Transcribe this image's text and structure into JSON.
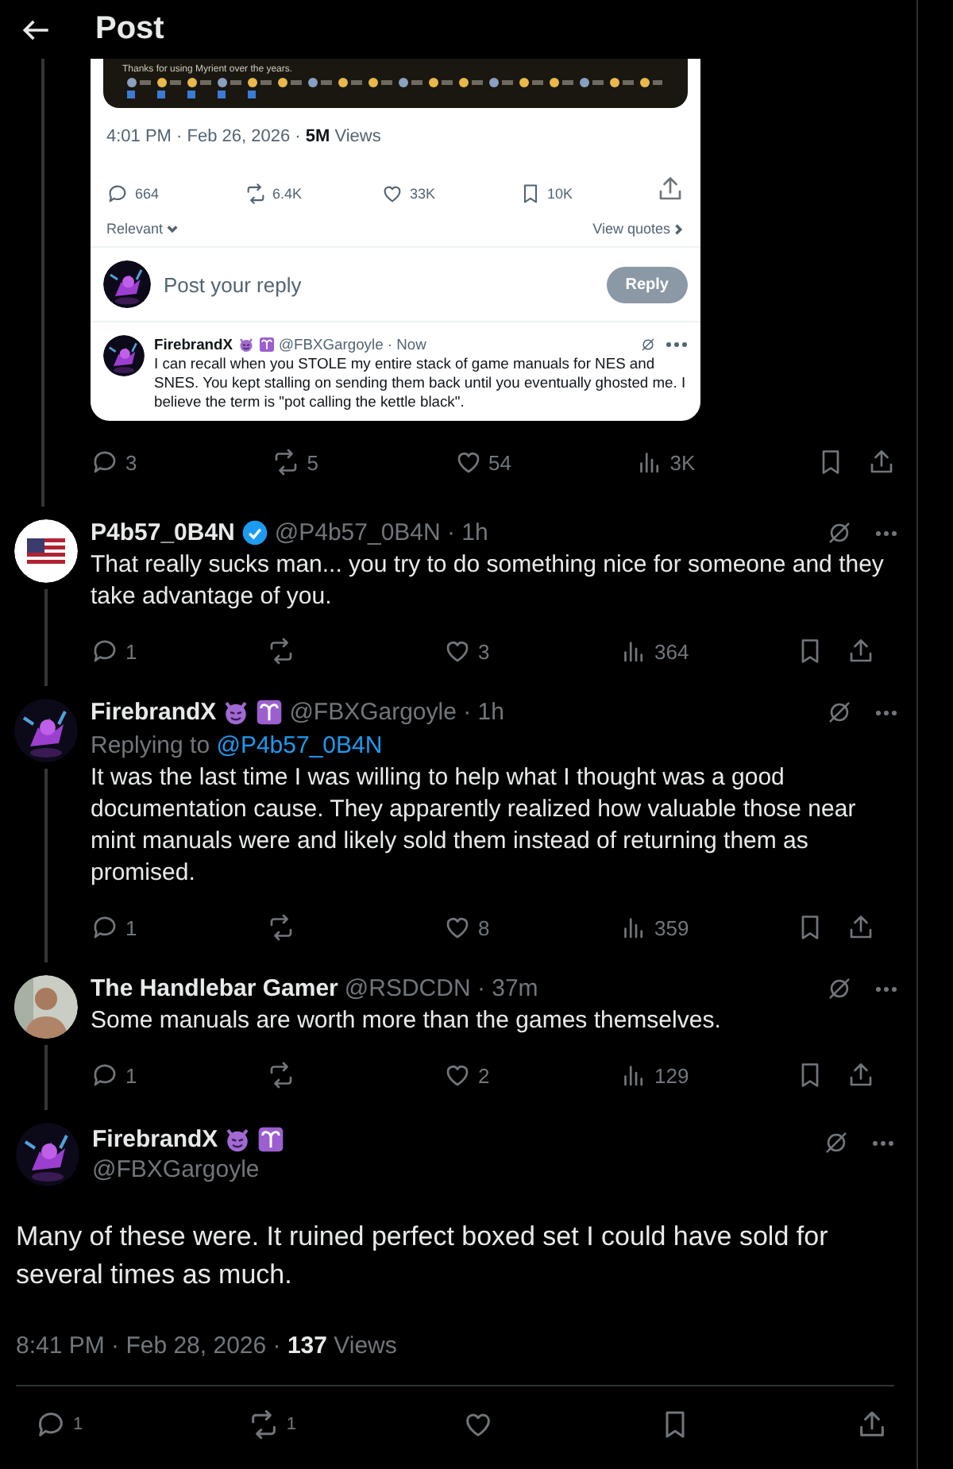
{
  "header": {
    "title": "Post"
  },
  "screenshot": {
    "banner_text": "Thanks for using Myrient over the years.",
    "timestamp": "4:01 PM · Feb 26, 2026 · **5M** Views",
    "actions": [
      {
        "kind": "reply",
        "count": "664"
      },
      {
        "kind": "repost",
        "count": "6.4K"
      },
      {
        "kind": "like",
        "count": "33K"
      },
      {
        "kind": "bookmark",
        "count": "10K"
      }
    ],
    "sort": "Relevant",
    "view_quotes": "View quotes",
    "composer": {
      "placeholder": "Post your reply",
      "button": "Reply"
    },
    "reply": {
      "name": "FirebrandX",
      "handle": "@FBXGargoyle · Now",
      "text": "I can recall when you STOLE my entire stack of game manuals for NES and SNES. You kept stalling on sending them back until you eventually ghosted me. I believe the term is \"pot calling the kettle black\"."
    }
  },
  "post_actions": [
    {
      "kind": "reply",
      "count": "3"
    },
    {
      "kind": "repost",
      "count": "5"
    },
    {
      "kind": "like",
      "count": "54"
    },
    {
      "kind": "views",
      "count": "3K"
    }
  ],
  "replies": [
    {
      "avatar": {
        "kind": "flag"
      },
      "name": "P4b57_0B4N",
      "verified": true,
      "handle": "@P4b57_0B4N · 1h",
      "text": "That really sucks man... you try to do something nice for someone and they take advantage of you.",
      "actions": [
        {
          "kind": "reply",
          "count": "1"
        },
        {
          "kind": "repost"
        },
        {
          "kind": "like",
          "count": "3"
        },
        {
          "kind": "views",
          "count": "364"
        }
      ]
    },
    {
      "avatar": {
        "kind": "creature"
      },
      "name": "FirebrandX",
      "verified": false,
      "badges": [
        {
          "kind": "devil"
        },
        {
          "kind": "aries"
        }
      ],
      "handle": "@FBXGargoyle · 1h",
      "replying_label": "Replying to",
      "replying_to": "@P4b57_0B4N",
      "text": "It was the last time I was willing to help what I thought was a good documentation cause. They apparently realized how valuable those near mint manuals were and likely sold them instead of returning them as promised.",
      "actions": [
        {
          "kind": "reply",
          "count": "1"
        },
        {
          "kind": "repost"
        },
        {
          "kind": "like",
          "count": "8"
        },
        {
          "kind": "views",
          "count": "359"
        }
      ]
    },
    {
      "avatar": {
        "kind": "person"
      },
      "name": "The Handlebar Gamer",
      "verified": false,
      "handle": "@RSDCDN · 37m",
      "text": "Some manuals are worth more than the games themselves.",
      "actions": [
        {
          "kind": "reply",
          "count": "1"
        },
        {
          "kind": "repost"
        },
        {
          "kind": "like",
          "count": "2"
        },
        {
          "kind": "views",
          "count": "129"
        }
      ]
    }
  ],
  "focused": {
    "avatar": {
      "kind": "creature"
    },
    "name": "FirebrandX",
    "badges": [
      {
        "kind": "devil"
      },
      {
        "kind": "aries"
      }
    ],
    "handle": "@FBXGargoyle",
    "text": "Many of these were. It ruined perfect boxed set I could have sold for several times as much.",
    "timestamp": "8:41 PM · Feb 28, 2026 · **137** Views",
    "actions": [
      {
        "kind": "reply",
        "count": "1"
      },
      {
        "kind": "repost",
        "count": "1"
      },
      {
        "kind": "like"
      },
      {
        "kind": "bookmark"
      }
    ]
  }
}
